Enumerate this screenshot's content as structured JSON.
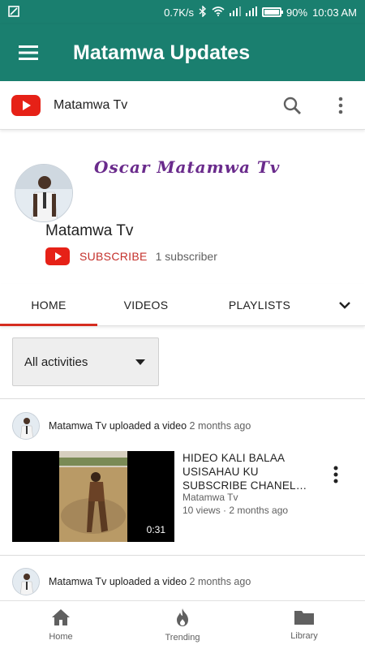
{
  "status_bar": {
    "speed": "0.7K/s",
    "battery": "90%",
    "battery_level": 0.9,
    "time": "10:03 AM"
  },
  "app_bar": {
    "title": "Matamwa Updates",
    "menu_icon": "hamburger-menu-icon"
  },
  "youtube_bar": {
    "logo_icon": "youtube-logo-icon",
    "channel": "Matamwa Tv",
    "search_icon": "search-icon",
    "more_icon": "more-vert-icon"
  },
  "channel": {
    "banner_text": "Oscar Matamwa Tv",
    "name": "Matamwa Tv",
    "subscribe_label": "SUBSCRIBE",
    "subscriber_count": "1 subscriber"
  },
  "tabs": [
    {
      "label": "HOME",
      "active": true
    },
    {
      "label": "VIDEOS",
      "active": false
    },
    {
      "label": "PLAYLISTS",
      "active": false
    }
  ],
  "filter": {
    "selected": "All activities"
  },
  "activities": [
    {
      "author": "Matamwa Tv",
      "action": "uploaded a video",
      "ago": "2 months ago",
      "video": {
        "title": "HIDEO KALI BALAA USISAHAU KU SUBSCRIBE CHANEL…",
        "channel": "Matamwa Tv",
        "meta": "10 views · 2 months ago",
        "duration": "0:31"
      }
    },
    {
      "author": "Matamwa Tv",
      "action": "uploaded a video",
      "ago": "2 months ago"
    }
  ],
  "bottom_nav": [
    {
      "label": "Home",
      "icon": "home-icon"
    },
    {
      "label": "Trending",
      "icon": "flame-icon"
    },
    {
      "label": "Library",
      "icon": "folder-icon"
    }
  ],
  "colors": {
    "primary": "#1a7f6f",
    "youtube_red": "#e62117",
    "tab_indicator": "#d52c1f",
    "banner_text": "#6a2b8c"
  }
}
